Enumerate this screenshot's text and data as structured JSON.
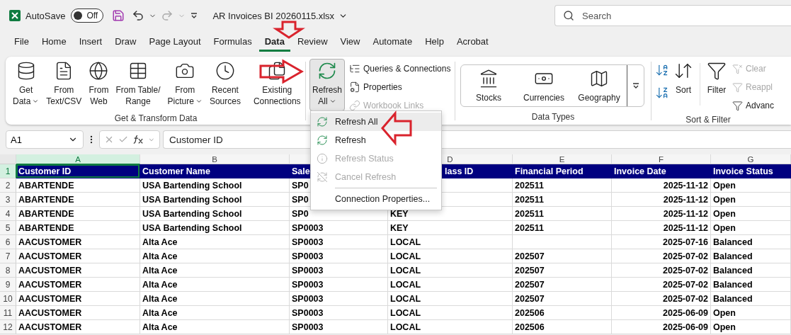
{
  "title_bar": {
    "autosave_label": "AutoSave",
    "autosave": {
      "on": false,
      "label": "Off"
    },
    "filename": "AR Invoices BI 20260115.xlsx",
    "search": {
      "placeholder": "Search"
    }
  },
  "tabs": [
    {
      "label": "File",
      "selected": false
    },
    {
      "label": "Home",
      "selected": false
    },
    {
      "label": "Insert",
      "selected": false
    },
    {
      "label": "Draw",
      "selected": false
    },
    {
      "label": "Page Layout",
      "selected": false
    },
    {
      "label": "Formulas",
      "selected": false
    },
    {
      "label": "Data",
      "selected": true
    },
    {
      "label": "Review",
      "selected": false
    },
    {
      "label": "View",
      "selected": false
    },
    {
      "label": "Automate",
      "selected": false
    },
    {
      "label": "Help",
      "selected": false
    },
    {
      "label": "Acrobat",
      "selected": false
    }
  ],
  "ribbon": {
    "get_transform": {
      "label": "Get & Transform Data",
      "buttons": [
        {
          "lines": [
            "Get",
            "Data"
          ],
          "dropdown": true
        },
        {
          "lines": [
            "From",
            "Text/CSV"
          ],
          "dropdown": false
        },
        {
          "lines": [
            "From",
            "Web"
          ],
          "dropdown": false
        },
        {
          "lines": [
            "From Table/",
            "Range"
          ],
          "dropdown": false
        },
        {
          "lines": [
            "From",
            "Picture"
          ],
          "dropdown": true
        },
        {
          "lines": [
            "Recent",
            "Sources"
          ],
          "dropdown": false
        },
        {
          "lines": [
            "Existing",
            "Connections"
          ],
          "dropdown": false
        }
      ]
    },
    "queries": {
      "refresh_all": {
        "lines": [
          "Refresh",
          "All"
        ],
        "dropdown": true,
        "pressed": true
      },
      "items": [
        {
          "label": "Queries & Connections",
          "disabled": false
        },
        {
          "label": "Properties",
          "disabled": false
        },
        {
          "label": "Workbook Links",
          "disabled": true
        }
      ]
    },
    "data_types": {
      "label": "Data Types",
      "items": [
        {
          "label": "Stocks"
        },
        {
          "label": "Currencies"
        },
        {
          "label": "Geography"
        }
      ]
    },
    "sort_filter": {
      "label": "Sort & Filter",
      "sort": "Sort",
      "filter": "Filter",
      "items": [
        {
          "label": "Clear",
          "disabled": true
        },
        {
          "label": "Reappl",
          "disabled": true
        },
        {
          "label": "Advanc",
          "disabled": false
        }
      ]
    }
  },
  "refresh_menu": [
    {
      "label": "Refresh All",
      "selected": true,
      "disabled": false,
      "separator_before": false
    },
    {
      "label": "Refresh",
      "selected": false,
      "disabled": false,
      "separator_before": false
    },
    {
      "label": "Refresh Status",
      "selected": false,
      "disabled": true,
      "separator_before": false
    },
    {
      "label": "Cancel Refresh",
      "selected": false,
      "disabled": true,
      "separator_before": false
    },
    {
      "label": "Connection Properties...",
      "selected": false,
      "disabled": false,
      "separator_before": true
    }
  ],
  "formula_bar": {
    "name_box": "A1",
    "value": "Customer ID"
  },
  "sheet": {
    "columns": [
      {
        "label": "A",
        "selected": true
      },
      {
        "label": "B",
        "selected": false
      },
      {
        "selected": false
      },
      {
        "label": "D",
        "selected": false
      },
      {
        "label": "E",
        "selected": false
      },
      {
        "label": "F",
        "selected": false
      },
      {
        "label": "G",
        "selected": false
      }
    ],
    "rows": [
      {
        "number": "1",
        "selected": true,
        "kind": "header",
        "cells": [
          "Customer ID",
          "Customer Name",
          "Sale",
          "lass ID",
          "Financial Period",
          "Invoice Date",
          "Invoice Status"
        ]
      },
      {
        "number": "2",
        "selected": false,
        "kind": "data",
        "cells": [
          "ABARTENDE",
          "USA Bartending School",
          "SP0",
          null,
          "202511",
          "2025-11-12",
          "Open"
        ]
      },
      {
        "number": "3",
        "selected": false,
        "kind": "data",
        "cells": [
          "ABARTENDE",
          "USA Bartending School",
          "SP0",
          null,
          "202511",
          "2025-11-12",
          "Open"
        ]
      },
      {
        "number": "4",
        "selected": false,
        "kind": "data",
        "cells": [
          "ABARTENDE",
          "USA Bartending School",
          "SP0",
          "KEY",
          "202511",
          "2025-11-12",
          "Open"
        ]
      },
      {
        "number": "5",
        "selected": false,
        "kind": "data",
        "cells": [
          "ABARTENDE",
          "USA Bartending School",
          "SP0003",
          "KEY",
          "202511",
          "2025-11-12",
          "Open"
        ]
      },
      {
        "number": "6",
        "selected": false,
        "kind": "data",
        "cells": [
          "AACUSTOMER",
          "Alta Ace",
          "SP0003",
          "LOCAL",
          null,
          "2025-07-16",
          "Balanced"
        ]
      },
      {
        "number": "7",
        "selected": false,
        "kind": "data",
        "cells": [
          "AACUSTOMER",
          "Alta Ace",
          "SP0003",
          "LOCAL",
          "202507",
          "2025-07-02",
          "Balanced"
        ]
      },
      {
        "number": "8",
        "selected": false,
        "kind": "data",
        "cells": [
          "AACUSTOMER",
          "Alta Ace",
          "SP0003",
          "LOCAL",
          "202507",
          "2025-07-02",
          "Balanced"
        ]
      },
      {
        "number": "9",
        "selected": false,
        "kind": "data",
        "cells": [
          "AACUSTOMER",
          "Alta Ace",
          "SP0003",
          "LOCAL",
          "202507",
          "2025-07-02",
          "Balanced"
        ]
      },
      {
        "number": "10",
        "selected": false,
        "kind": "data",
        "cells": [
          "AACUSTOMER",
          "Alta Ace",
          "SP0003",
          "LOCAL",
          "202507",
          "2025-07-02",
          "Balanced"
        ]
      },
      {
        "number": "11",
        "selected": false,
        "kind": "data",
        "cells": [
          "AACUSTOMER",
          "Alta Ace",
          "SP0003",
          "LOCAL",
          "202506",
          "2025-06-09",
          "Open"
        ]
      },
      {
        "number": "12",
        "selected": false,
        "kind": "data",
        "cells": [
          "AACUSTOMER",
          "Alta Ace",
          "SP0003",
          "LOCAL",
          "202506",
          "2025-06-09",
          "Open"
        ]
      }
    ]
  }
}
